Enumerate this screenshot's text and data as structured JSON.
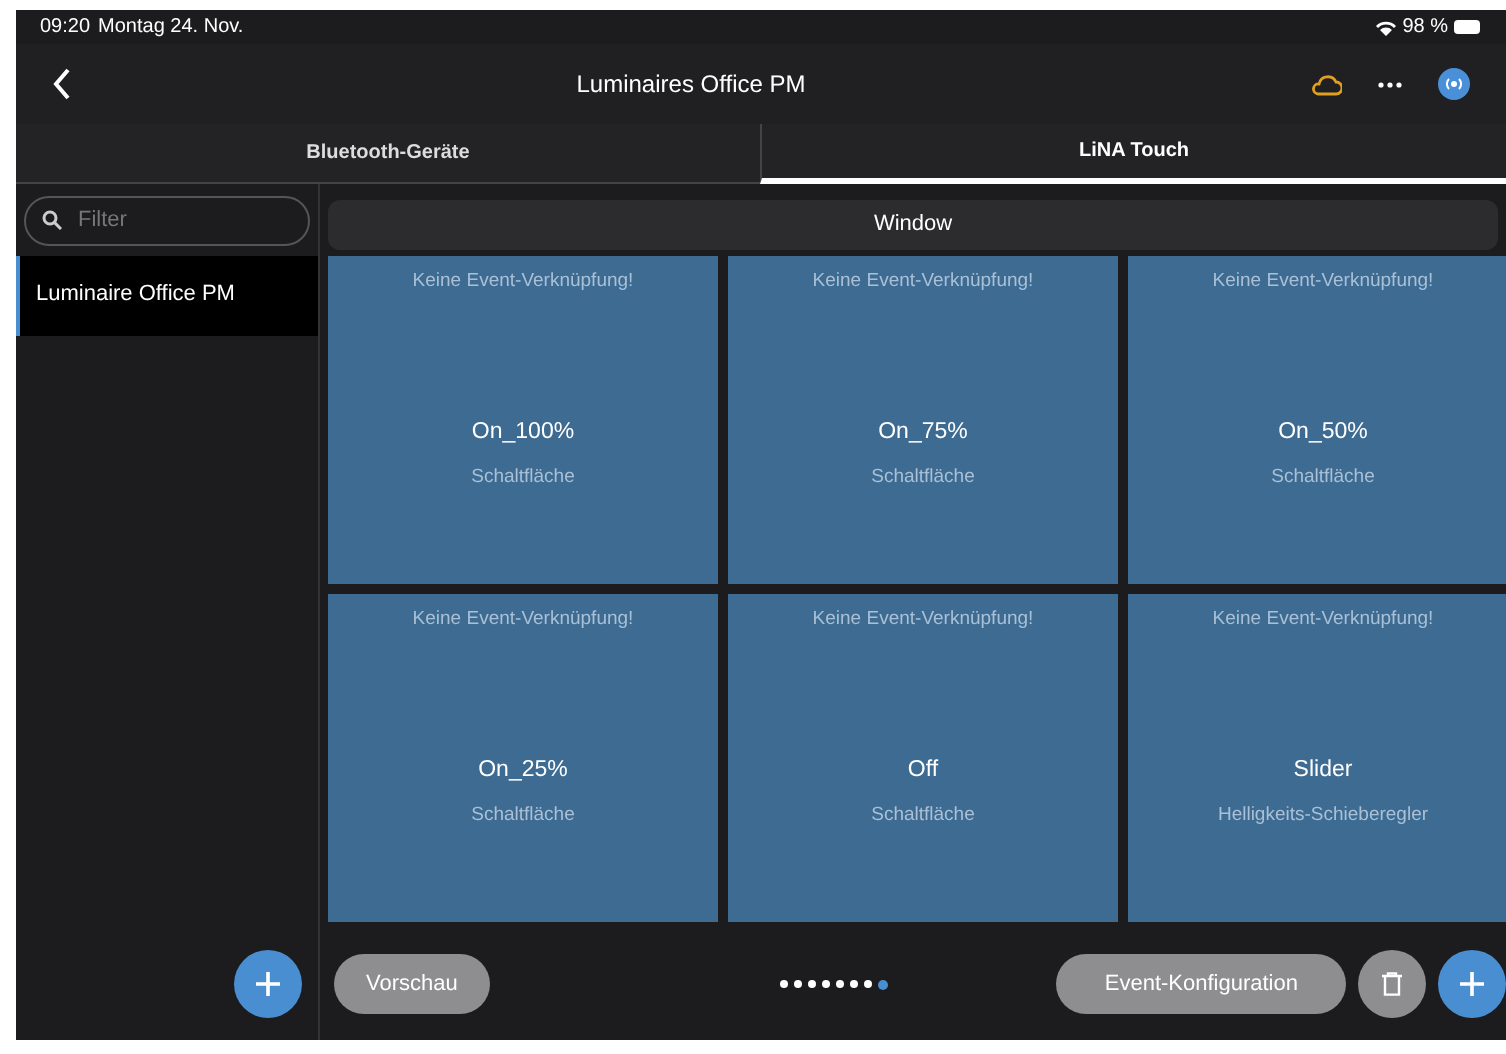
{
  "status_bar": {
    "time": "09:20",
    "date": "Montag 24. Nov.",
    "battery": "98 %"
  },
  "nav": {
    "title": "Luminaires Office PM"
  },
  "tabs": [
    {
      "label": "Bluetooth-Geräte",
      "selected": false
    },
    {
      "label": "LiNA Touch",
      "selected": true
    }
  ],
  "sidebar": {
    "search": {
      "placeholder": "Filter"
    },
    "items": [
      {
        "label": "Luminaire Office PM",
        "selected": true
      }
    ]
  },
  "window": {
    "title": "Window"
  },
  "tiles": [
    {
      "status": "Keine Event-Verknüpfung!",
      "name": "On_100%",
      "type": "Schaltfläche"
    },
    {
      "status": "Keine Event-Verknüpfung!",
      "name": "On_75%",
      "type": "Schaltfläche"
    },
    {
      "status": "Keine Event-Verknüpfung!",
      "name": "On_50%",
      "type": "Schaltfläche"
    },
    {
      "status": "Keine Event-Verknüpfung!",
      "name": "On_25%",
      "type": "Schaltfläche"
    },
    {
      "status": "Keine Event-Verknüpfung!",
      "name": "Off",
      "type": "Schaltfläche"
    },
    {
      "status": "Keine Event-Verknüpfung!",
      "name": "Slider",
      "type": "Helligkeits-Schieberegler"
    }
  ],
  "pages": [
    {
      "selected": false
    },
    {
      "selected": false
    },
    {
      "selected": false
    },
    {
      "selected": false
    },
    {
      "selected": false
    },
    {
      "selected": false
    },
    {
      "selected": false
    },
    {
      "selected": true
    }
  ],
  "buttons": {
    "preview": "Vorschau",
    "event_config": "Event-Konfiguration"
  }
}
